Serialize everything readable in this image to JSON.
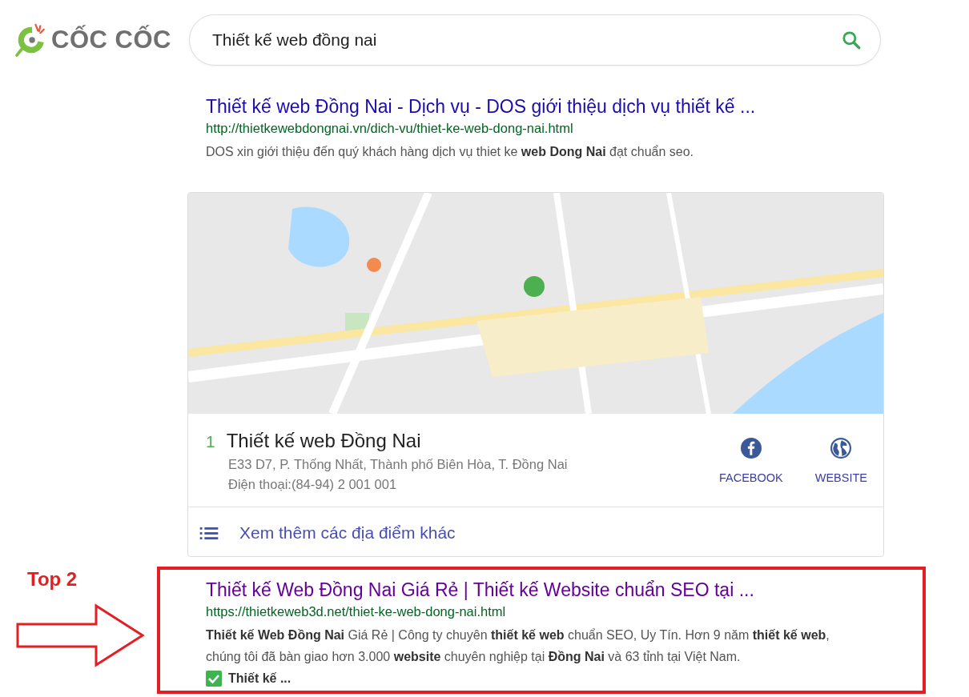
{
  "logo": {
    "text": "CỐC CỐC"
  },
  "search": {
    "value": "Thiết kế web đồng nai"
  },
  "results": [
    {
      "kind": "web",
      "title": "Thiết kế web Đồng Nai - Dịch vụ - DOS giới thiệu dịch vụ thiết kế ...",
      "visited": false,
      "url": "http://thietkewebdongnai.vn/dich-vu/thiet-ke-web-dong-nai.html",
      "snippet": "DOS xin giới thiệu đến quý khách hàng dịch vụ thiet ke **web Dong Nai** đạt chuẩn seo.",
      "highlighted": false
    },
    {
      "kind": "local",
      "place": {
        "number": "1",
        "name": "Thiết kế web Đồng Nai",
        "address": "E33 D7, P. Thống Nhất, Thành phố Biên Hòa, T. Đồng Nai",
        "phone": "Điện thoại:(84-94) 2 001 001",
        "actions": [
          {
            "kind": "facebook",
            "label": "FACEBOOK"
          },
          {
            "kind": "website",
            "label": "WEBSITE"
          }
        ]
      },
      "more": "Xem thêm các địa điểm khác"
    },
    {
      "kind": "web",
      "title": "Thiết kế Web Đồng Nai Giá Rẻ | Thiết kế Website chuẩn SEO tại ...",
      "visited": true,
      "url": "https://thietkeweb3d.net/thiet-ke-web-dong-nai.html",
      "snippet": "**Thiết kế Web Đồng Nai** Giá Rẻ | Công ty chuyên **thiết kế web** chuẩn SEO, Uy Tín. Hơn 9 năm **thiết kế web**, chúng tôi đã bàn giao hơn 3.000 **website** chuyên nghiệp tại **Đồng Nai** và 63 tỉnh tại Việt Nam.",
      "check_line": "Thiết kế ...",
      "highlighted": true,
      "annotation": "Top 2"
    }
  ]
}
